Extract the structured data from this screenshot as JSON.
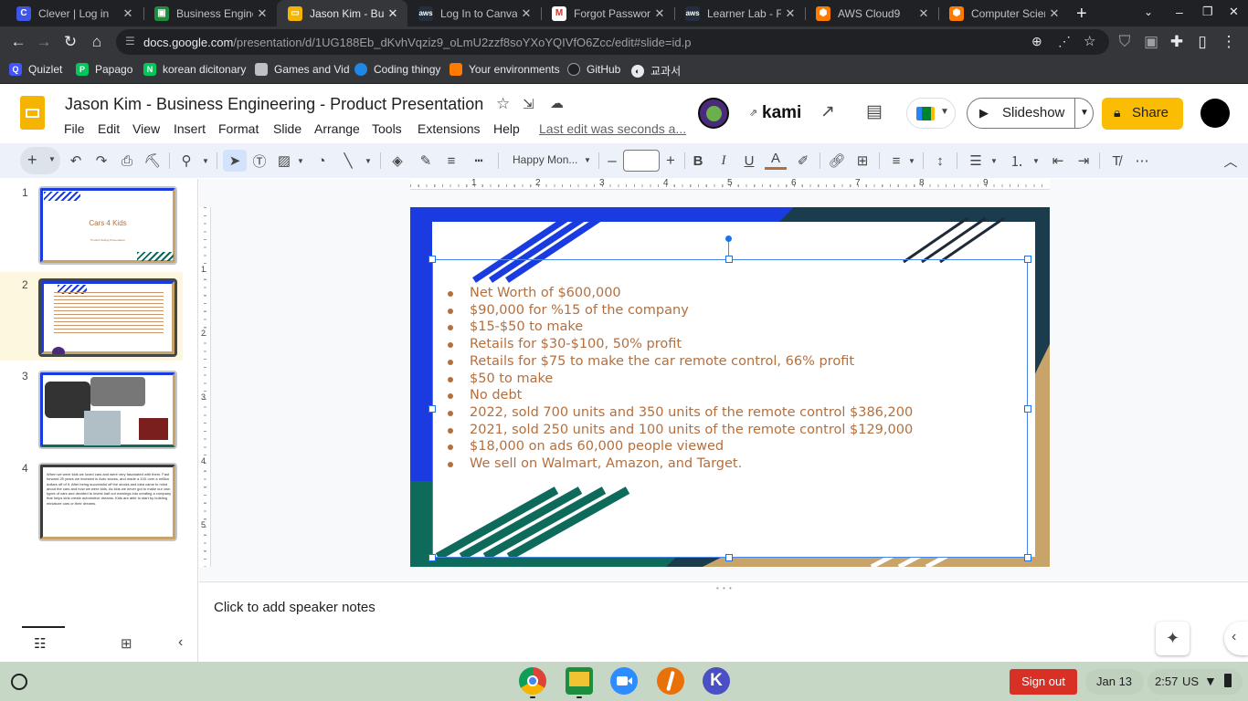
{
  "browser": {
    "tabs": [
      {
        "title": "Clever | Log in",
        "icon": "clever-icon",
        "color": "#3e55e6",
        "letter": "C"
      },
      {
        "title": "Business Engineer",
        "icon": "classroom-icon",
        "color": "#1e8e3e",
        "letter": ""
      },
      {
        "title": "Jason Kim - Busin",
        "icon": "slides-icon",
        "color": "#f4b400",
        "letter": "",
        "active": true
      },
      {
        "title": "Log In to Canvas",
        "icon": "aws-icon",
        "color": "#444",
        "letter": ""
      },
      {
        "title": "Forgot Password",
        "icon": "gmail-icon",
        "color": "#fff",
        "letter": "M"
      },
      {
        "title": "Learner Lab - Fou",
        "icon": "aws-icon",
        "color": "#444",
        "letter": ""
      },
      {
        "title": "AWS Cloud9",
        "icon": "aws-cube-icon",
        "color": "#ff7b00",
        "letter": ""
      },
      {
        "title": "Computer Science",
        "icon": "aws-cube-icon",
        "color": "#ff7b00",
        "letter": ""
      }
    ],
    "url_host": "docs.google.com",
    "url_path": "/presentation/d/1UG188Eb_dKvhVqziz9_oLmU2zzf8soYXoYQIVfO6Zcc/edit#slide=id.p",
    "bookmarks": [
      {
        "label": "Quizlet"
      },
      {
        "label": "Papago"
      },
      {
        "label": "korean dicitonary"
      },
      {
        "label": "Games and Vid"
      },
      {
        "label": "Coding thingy"
      },
      {
        "label": "Your environments"
      },
      {
        "label": "GitHub"
      },
      {
        "label": "교과서"
      }
    ]
  },
  "app": {
    "title": "Jason Kim - Business Engineering - Product Presentation",
    "menus": [
      "File",
      "Edit",
      "View",
      "Insert",
      "Format",
      "Slide",
      "Arrange",
      "Tools",
      "Extensions",
      "Help"
    ],
    "last_edit": "Last edit was seconds a...",
    "kami_label": "kami",
    "slideshow_label": "Slideshow",
    "share_label": "Share",
    "font_name": "Happy Mon...",
    "font_size": ""
  },
  "ruler": [
    "1",
    "2",
    "3",
    "4",
    "5",
    "6",
    "7",
    "8",
    "9"
  ],
  "vruler": [
    "1",
    "2",
    "3",
    "4",
    "5"
  ],
  "filmstrip": {
    "slides": [
      {
        "num": "1",
        "title": "Cars 4 Kids",
        "subtitle": "Product Selling Presentation"
      },
      {
        "num": "2"
      },
      {
        "num": "3"
      },
      {
        "num": "4",
        "text": "When we were kids we loved cars and were very fascinated with them. Fast forward 25 years we invested in Auto stocks, and made a 10X over a million dollars off of it. After being successful off the stocks and idea came to mind about the cars and how we were kids. As kids we never got to make our own types of cars and decided to invest half our earnings into creating a company that helps kids create automotive dreams. Kids are able to start by building miniature cars or their dreams."
      }
    ]
  },
  "slide": {
    "bullets": [
      "Net Worth of $600,000",
      "$90,000 for %15 of the company",
      "$15-$50 to make",
      "Retails for $30-$100, 50% profit",
      "Retails for $75 to make the car remote control, 66% profit",
      "$50 to make",
      "No debt",
      "2022, sold 700 units and 350 units of the remote control $386,200",
      "2021, sold 250 units and 100 units of the remote control  $129,000",
      "$18,000 on ads 60,000 people viewed",
      "We sell on Walmart, Amazon, and Target."
    ]
  },
  "notes": {
    "placeholder": "Click to add speaker notes"
  },
  "shelf": {
    "sign_out": "Sign out",
    "date": "Jan 13",
    "time": "2:57",
    "locale": "US"
  },
  "colors": {
    "accent": "#b46f3e",
    "slide_blue": "#1a3be0",
    "slide_teal": "#0e6b5c",
    "slide_gold": "#c8a46a",
    "share_bg": "#fbbc04",
    "signout_bg": "#d93025"
  }
}
